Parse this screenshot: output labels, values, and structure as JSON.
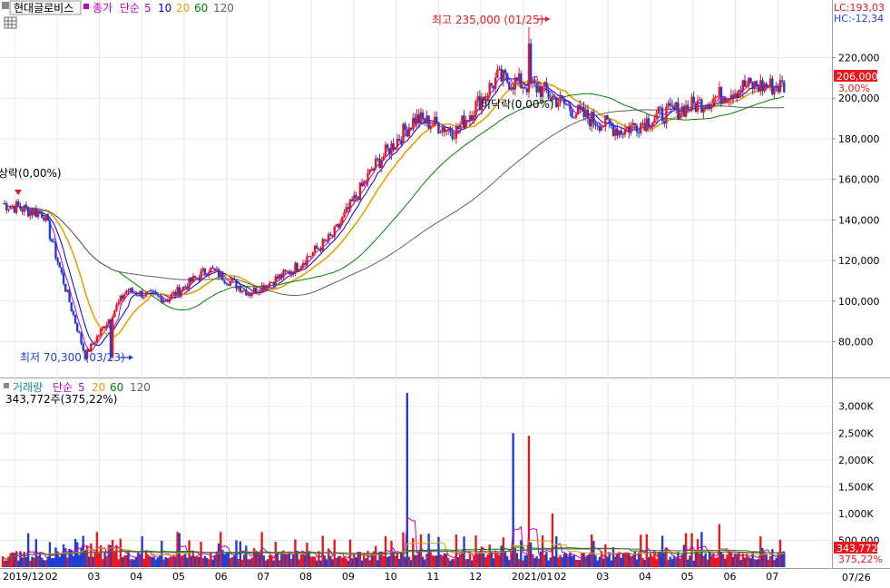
{
  "header": {
    "stock_name": "현대글로비스",
    "price_label": "종가",
    "ma_type": "단순",
    "ma_periods": [
      "5",
      "10",
      "20",
      "60",
      "120"
    ],
    "lc_label": "LC:193,03",
    "hc_label": "HC:-12,34"
  },
  "volume_header": {
    "label": "거래량",
    "ma_type": "단순",
    "ma_periods": [
      "5",
      "20",
      "60",
      "120"
    ],
    "current": "343,772주(375,22%)"
  },
  "annotations": {
    "high": "최고 235,000 (01/25)",
    "low": "최저 70,300 (03/23)",
    "upper_limit_left": "상락(0,00%)",
    "lower_limit_mid": "비닥락(0,00%)"
  },
  "price_axis": {
    "ticks": [
      "220,000",
      "200,000",
      "180,000",
      "160,000",
      "140,000",
      "120,000",
      "100,000",
      "80,000"
    ],
    "current_price": "206,000",
    "current_change": "3,00%"
  },
  "volume_axis": {
    "ticks": [
      "3,000K",
      "2,500K",
      "2,000K",
      "1,500K",
      "1,000K",
      "500,000"
    ],
    "current_volume": "343,772",
    "current_ratio": "375,22%"
  },
  "time_axis": {
    "labels": [
      "2019/12",
      "02",
      "03",
      "04",
      "05",
      "06",
      "07",
      "08",
      "09",
      "10",
      "11",
      "12",
      "2021/01",
      "02",
      "03",
      "04",
      "05",
      "06",
      "07"
    ],
    "corner_label": "07/26"
  },
  "colors": {
    "up": "#e8191c",
    "down": "#1f3fd0",
    "ma5": "#c000c0",
    "ma10": "#0000d0",
    "ma20": "#e8a000",
    "ma60": "#008000",
    "ma120": "#606060",
    "grid": "#e8e8e8",
    "price_tag": "#e8191c"
  },
  "chart_data": {
    "type": "line",
    "title": "현대글로비스",
    "price_series": [
      {
        "date": "2020-01",
        "close": 148000
      },
      {
        "date": "2020-02",
        "close": 143000
      },
      {
        "date": "2020-03",
        "close": 73000
      },
      {
        "date": "2020-04",
        "close": 105000
      },
      {
        "date": "2020-05",
        "close": 101000
      },
      {
        "date": "2020-06",
        "close": 116000
      },
      {
        "date": "2020-07",
        "close": 104000
      },
      {
        "date": "2020-08",
        "close": 115000
      },
      {
        "date": "2020-09",
        "close": 132000
      },
      {
        "date": "2020-10",
        "close": 166000
      },
      {
        "date": "2020-11",
        "close": 190000
      },
      {
        "date": "2020-12",
        "close": 184000
      },
      {
        "date": "2021-01",
        "close": 210000
      },
      {
        "date": "2021-02",
        "close": 205000
      },
      {
        "date": "2021-03",
        "close": 192000
      },
      {
        "date": "2021-04",
        "close": 184000
      },
      {
        "date": "2021-05",
        "close": 192000
      },
      {
        "date": "2021-06",
        "close": 198000
      },
      {
        "date": "2021-07",
        "close": 206000
      }
    ],
    "high": {
      "value": 235000,
      "date": "01/25"
    },
    "low": {
      "value": 70300,
      "date": "03/23"
    },
    "ylim": [
      65000,
      235000
    ],
    "volume_ylim": [
      0,
      3300000
    ],
    "volume_spikes": [
      {
        "date": "2020-10",
        "value": 3250000
      },
      {
        "date": "2021-01",
        "value": 2500000
      },
      {
        "date": "2021-01",
        "value": 2450000
      },
      {
        "date": "2021-02",
        "value": 1000000
      },
      {
        "date": "2021-06",
        "value": 800000
      }
    ]
  }
}
